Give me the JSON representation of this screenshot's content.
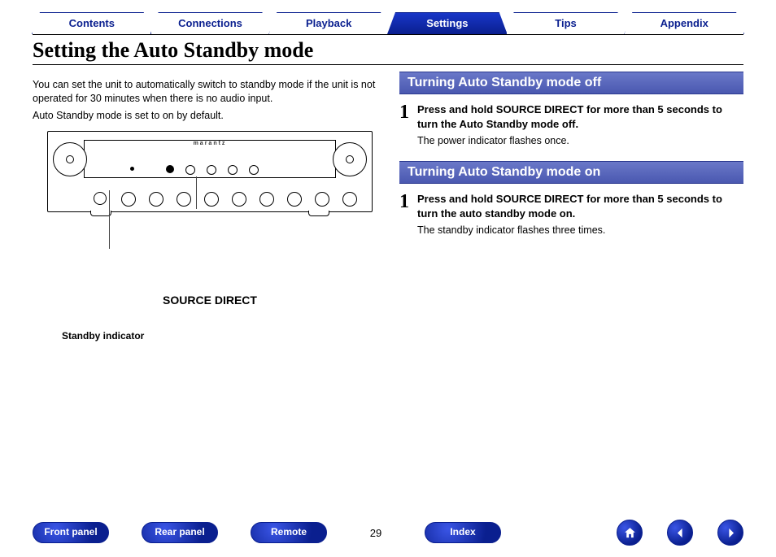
{
  "tabs": {
    "items": [
      {
        "label": "Contents",
        "active": false
      },
      {
        "label": "Connections",
        "active": false
      },
      {
        "label": "Playback",
        "active": false
      },
      {
        "label": "Settings",
        "active": true
      },
      {
        "label": "Tips",
        "active": false
      },
      {
        "label": "Appendix",
        "active": false
      }
    ]
  },
  "page": {
    "title": "Setting the Auto Standby mode",
    "intro_line1": "You can set the unit to automatically switch to standby mode if the unit is not operated for 30 minutes when there is no audio input.",
    "intro_line2": "Auto Standby mode is set to on by default.",
    "number": "29"
  },
  "diagram": {
    "brand": "marantz",
    "source_direct_label": "SOURCE DIRECT",
    "standby_indicator_label": "Standby indicator"
  },
  "sections": {
    "off": {
      "title": "Turning Auto Standby mode off",
      "step_num": "1",
      "step_bold": "Press and hold SOURCE DIRECT for more than 5 seconds to turn the Auto Standby mode off.",
      "step_sub": "The power indicator flashes once."
    },
    "on": {
      "title": "Turning Auto Standby mode on",
      "step_num": "1",
      "step_bold": "Press and hold SOURCE DIRECT for more than 5 seconds to turn the auto standby mode on.",
      "step_sub": "The standby indicator flashes three times."
    }
  },
  "footer": {
    "buttons": [
      "Front panel",
      "Rear panel",
      "Remote",
      "Index"
    ],
    "icons": [
      "home-icon",
      "back-icon",
      "forward-icon"
    ]
  }
}
